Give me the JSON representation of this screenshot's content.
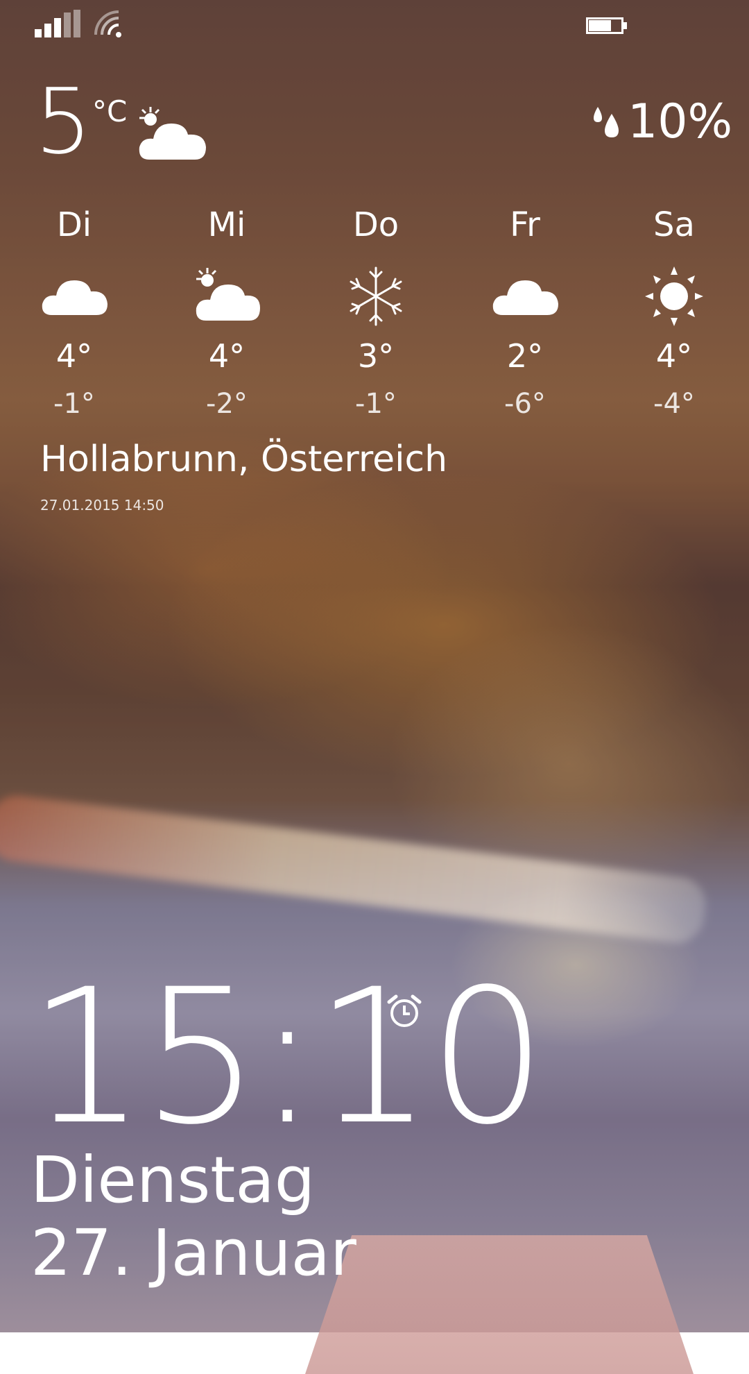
{
  "status_bar": {
    "signal_icon": "signal-bars-icon",
    "wifi_icon": "wifi-icon",
    "battery_icon": "battery-icon",
    "battery_level": 0.7
  },
  "current_weather": {
    "temperature": "5",
    "unit": "°C",
    "condition_icon": "partly-cloudy-icon",
    "precipitation_icon": "raindrops-icon",
    "precipitation": "10%"
  },
  "forecast": [
    {
      "day": "Di",
      "icon": "cloud-icon",
      "high": "4°",
      "low": "-1°"
    },
    {
      "day": "Mi",
      "icon": "partly-cloudy-icon",
      "high": "4°",
      "low": "-2°"
    },
    {
      "day": "Do",
      "icon": "snowflake-icon",
      "high": "3°",
      "low": "-1°"
    },
    {
      "day": "Fr",
      "icon": "cloud-icon",
      "high": "2°",
      "low": "-6°"
    },
    {
      "day": "Sa",
      "icon": "sun-icon",
      "high": "4°",
      "low": "-4°"
    }
  ],
  "location": {
    "name": "Hollabrunn, Österreich",
    "updated": "27.01.2015 14:50"
  },
  "lock_screen": {
    "time": "15:10",
    "alarm_icon": "alarm-clock-icon",
    "weekday": "Dienstag",
    "date": "27. Januar"
  }
}
